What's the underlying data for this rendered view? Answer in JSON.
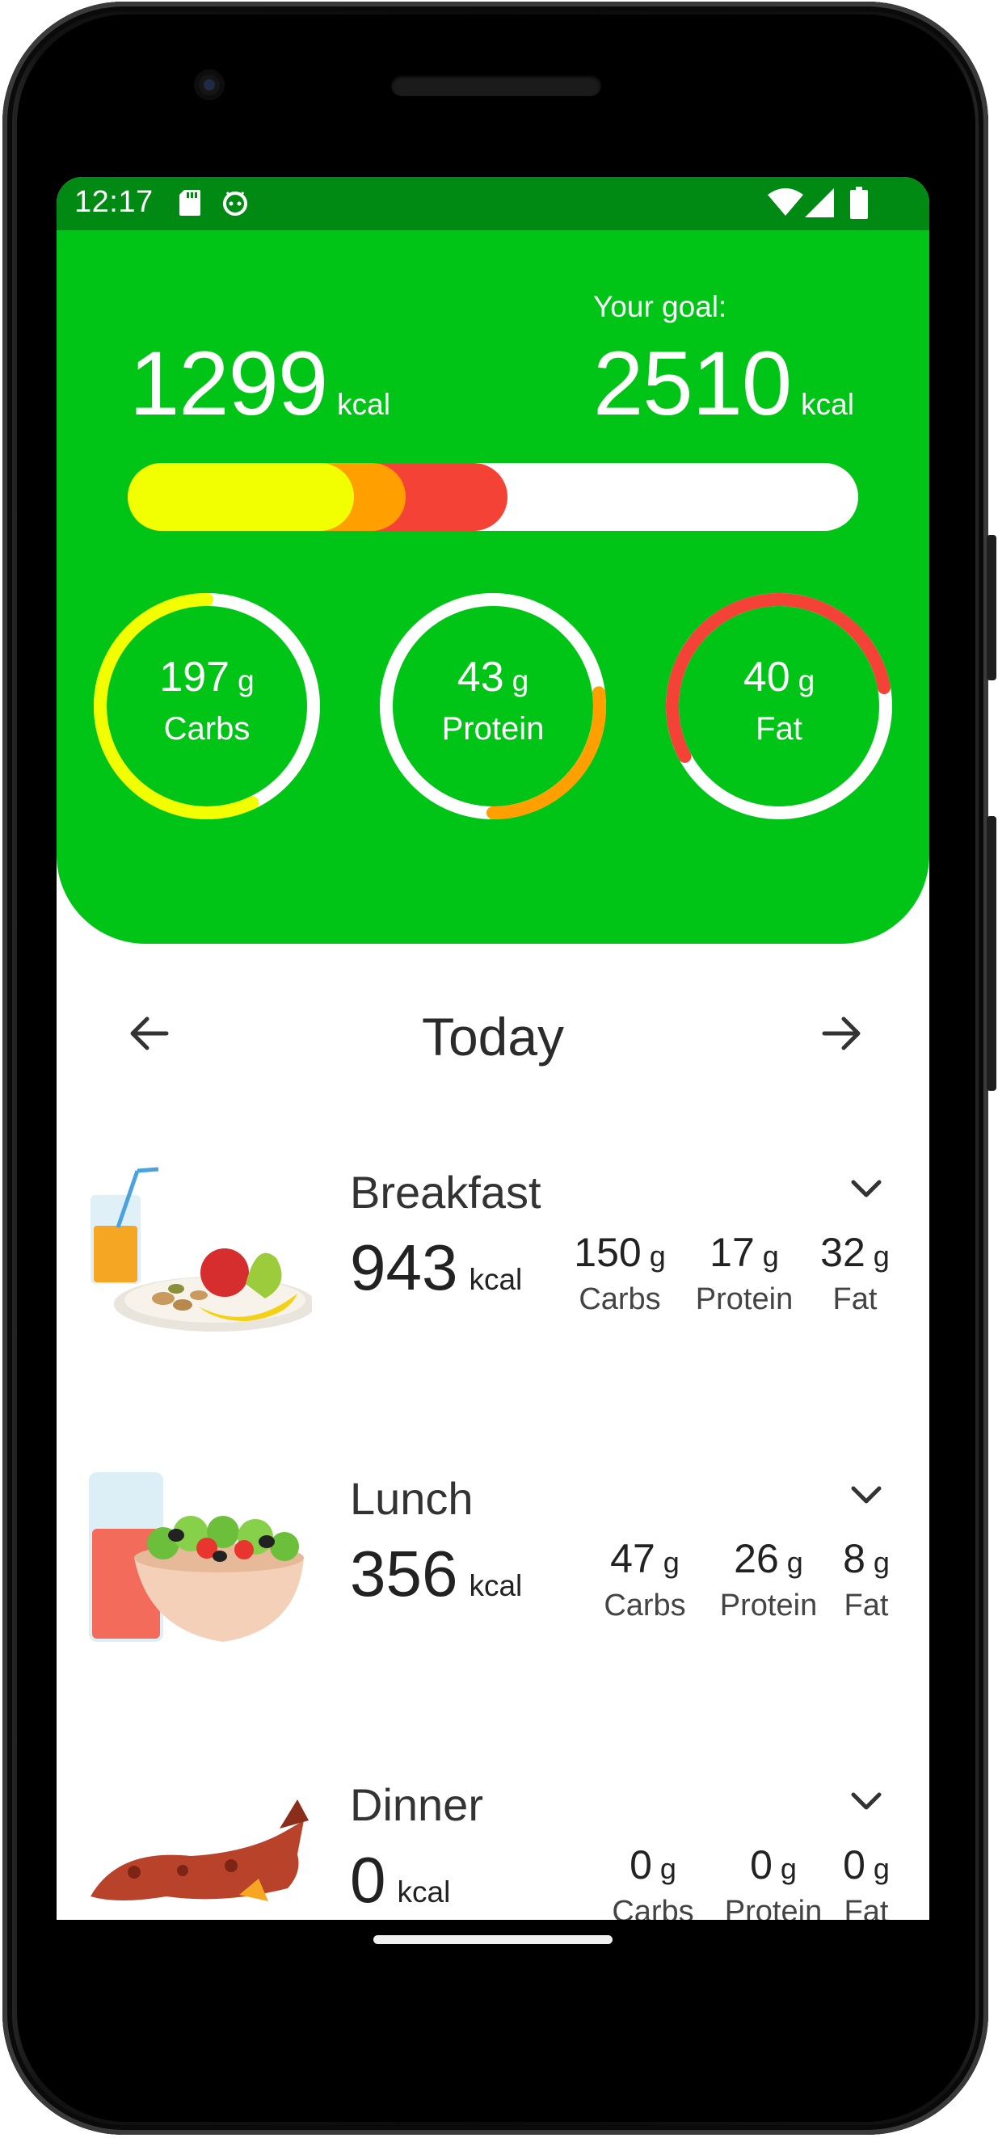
{
  "status_bar": {
    "time": "12:17",
    "icons": [
      "sd-card-icon",
      "android-icon",
      "wifi-icon",
      "signal-icon",
      "battery-icon"
    ]
  },
  "summary": {
    "eaten_kcal": "1299",
    "eaten_unit": "kcal",
    "goal_label": "Your goal:",
    "goal_kcal": "2510",
    "goal_unit": "kcal",
    "progress": {
      "carbs_fraction": 0.31,
      "protein_fraction": 0.38,
      "fat_fraction": 0.52
    },
    "macros": [
      {
        "value": "197",
        "unit": "g",
        "label": "Carbs",
        "color": "#f2ff00",
        "fraction": 0.57
      },
      {
        "value": "43",
        "unit": "g",
        "label": "Protein",
        "color": "#ff9f00",
        "fraction": 0.27
      },
      {
        "value": "40",
        "unit": "g",
        "label": "Fat",
        "color": "#f44336",
        "fraction": 0.55
      }
    ]
  },
  "date_nav": {
    "label": "Today",
    "prev_icon": "arrow-left-icon",
    "next_icon": "arrow-right-icon"
  },
  "meals": [
    {
      "name": "Breakfast",
      "kcal": "943",
      "kcal_unit": "kcal",
      "carbs": "150",
      "protein": "17",
      "fat": "32",
      "unit": "g",
      "carbs_label": "Carbs",
      "protein_label": "Protein",
      "fat_label": "Fat"
    },
    {
      "name": "Lunch",
      "kcal": "356",
      "kcal_unit": "kcal",
      "carbs": "47",
      "protein": "26",
      "fat": "8",
      "unit": "g",
      "carbs_label": "Carbs",
      "protein_label": "Protein",
      "fat_label": "Fat"
    },
    {
      "name": "Dinner",
      "kcal": "0",
      "kcal_unit": "kcal",
      "carbs": "0",
      "protein": "0",
      "fat": "0",
      "unit": "g",
      "carbs_label": "Carbs",
      "protein_label": "Protein",
      "fat_label": "Fat"
    }
  ],
  "colors": {
    "status_green": "#018a13",
    "header_green": "#00c516",
    "carbs": "#f2ff00",
    "protein": "#ff9f00",
    "fat": "#f44336"
  }
}
